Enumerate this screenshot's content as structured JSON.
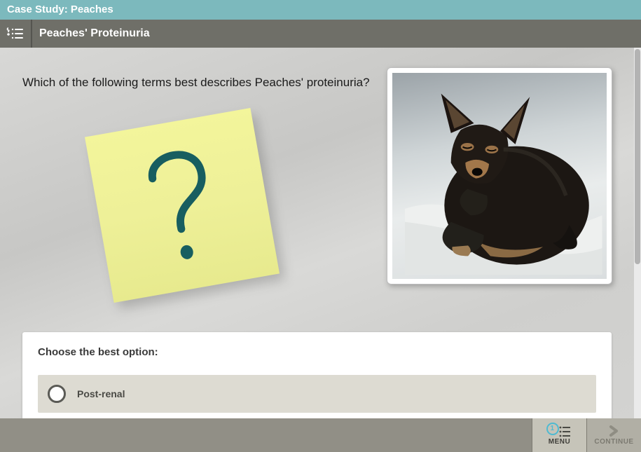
{
  "titlebar": {
    "title": "Case Study: Peaches"
  },
  "subbar": {
    "subtitle": "Peaches' Proteinuria",
    "icon": "question-list-icon"
  },
  "question": {
    "text": "Which of the following terms best describes Peaches' proteinuria?"
  },
  "sticky": {
    "glyph": "question-mark"
  },
  "photo": {
    "alt": "dog-photo"
  },
  "answer": {
    "prompt": "Choose the best option:",
    "options": [
      {
        "label": "Post-renal",
        "selected": false
      }
    ]
  },
  "footer": {
    "menu": {
      "label": "MENU",
      "badge": "1"
    },
    "continue": {
      "label": "CONTINUE"
    }
  }
}
